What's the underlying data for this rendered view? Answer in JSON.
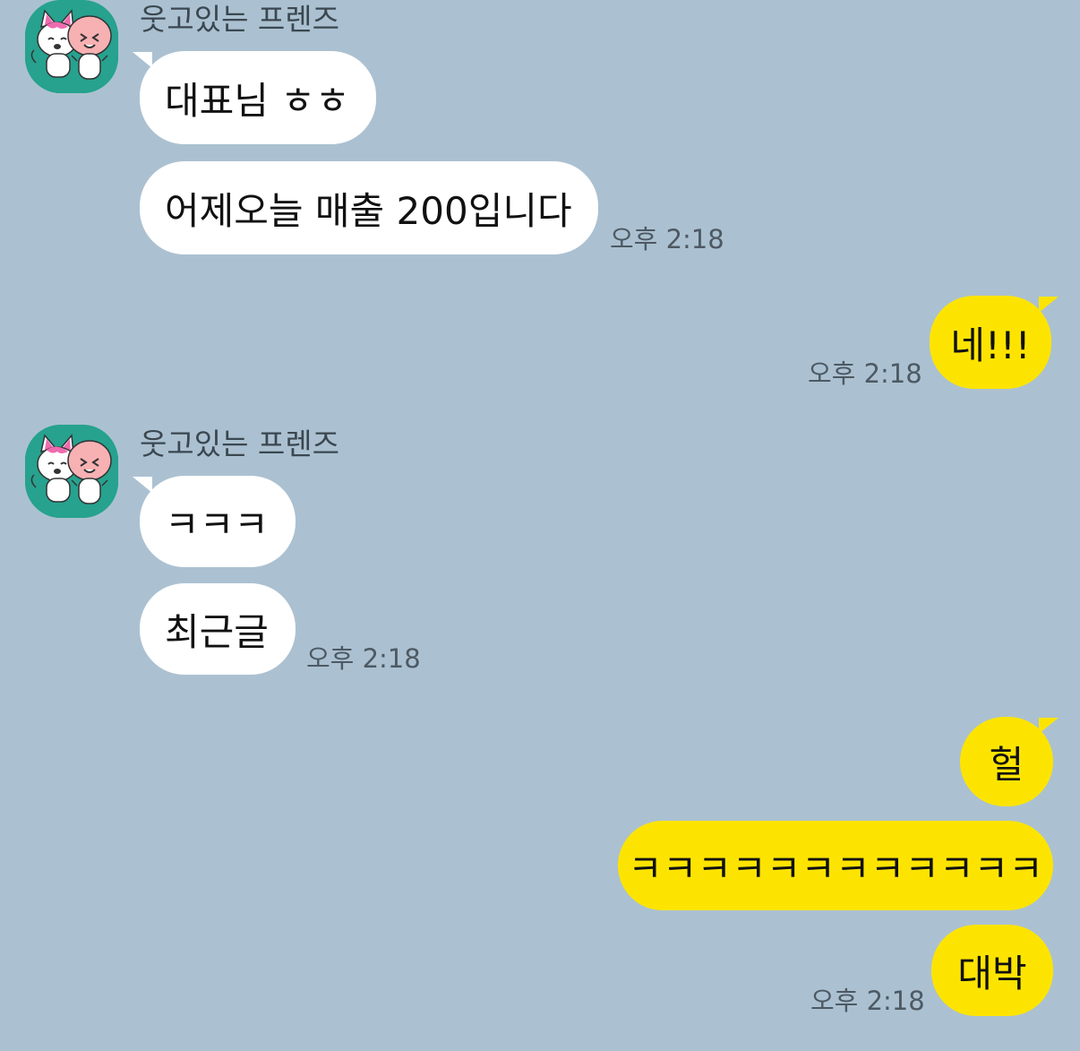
{
  "chat": {
    "colors": {
      "background": "#abc1d1",
      "incoming_bubble": "#ffffff",
      "outgoing_bubble": "#fde400",
      "avatar_bg": "#26a28f"
    },
    "groups": [
      {
        "direction": "incoming",
        "sender": "웃고있는 프렌즈",
        "avatar": "apeach-and-cat-sticker",
        "messages": [
          "대표님 ㅎㅎ",
          "어제오늘 매출 200입니다"
        ],
        "time": "오후 2:18"
      },
      {
        "direction": "outgoing",
        "messages": [
          "네!!!"
        ],
        "time": "오후 2:18"
      },
      {
        "direction": "incoming",
        "sender": "웃고있는 프렌즈",
        "avatar": "apeach-and-cat-sticker",
        "messages": [
          "ㅋㅋㅋ",
          "최근글"
        ],
        "time": "오후 2:18"
      },
      {
        "direction": "outgoing",
        "messages": [
          "헐",
          "ㅋㅋㅋㅋㅋㅋㅋㅋㅋㅋㅋㅋ",
          "대박"
        ],
        "time": "오후 2:18"
      }
    ]
  }
}
